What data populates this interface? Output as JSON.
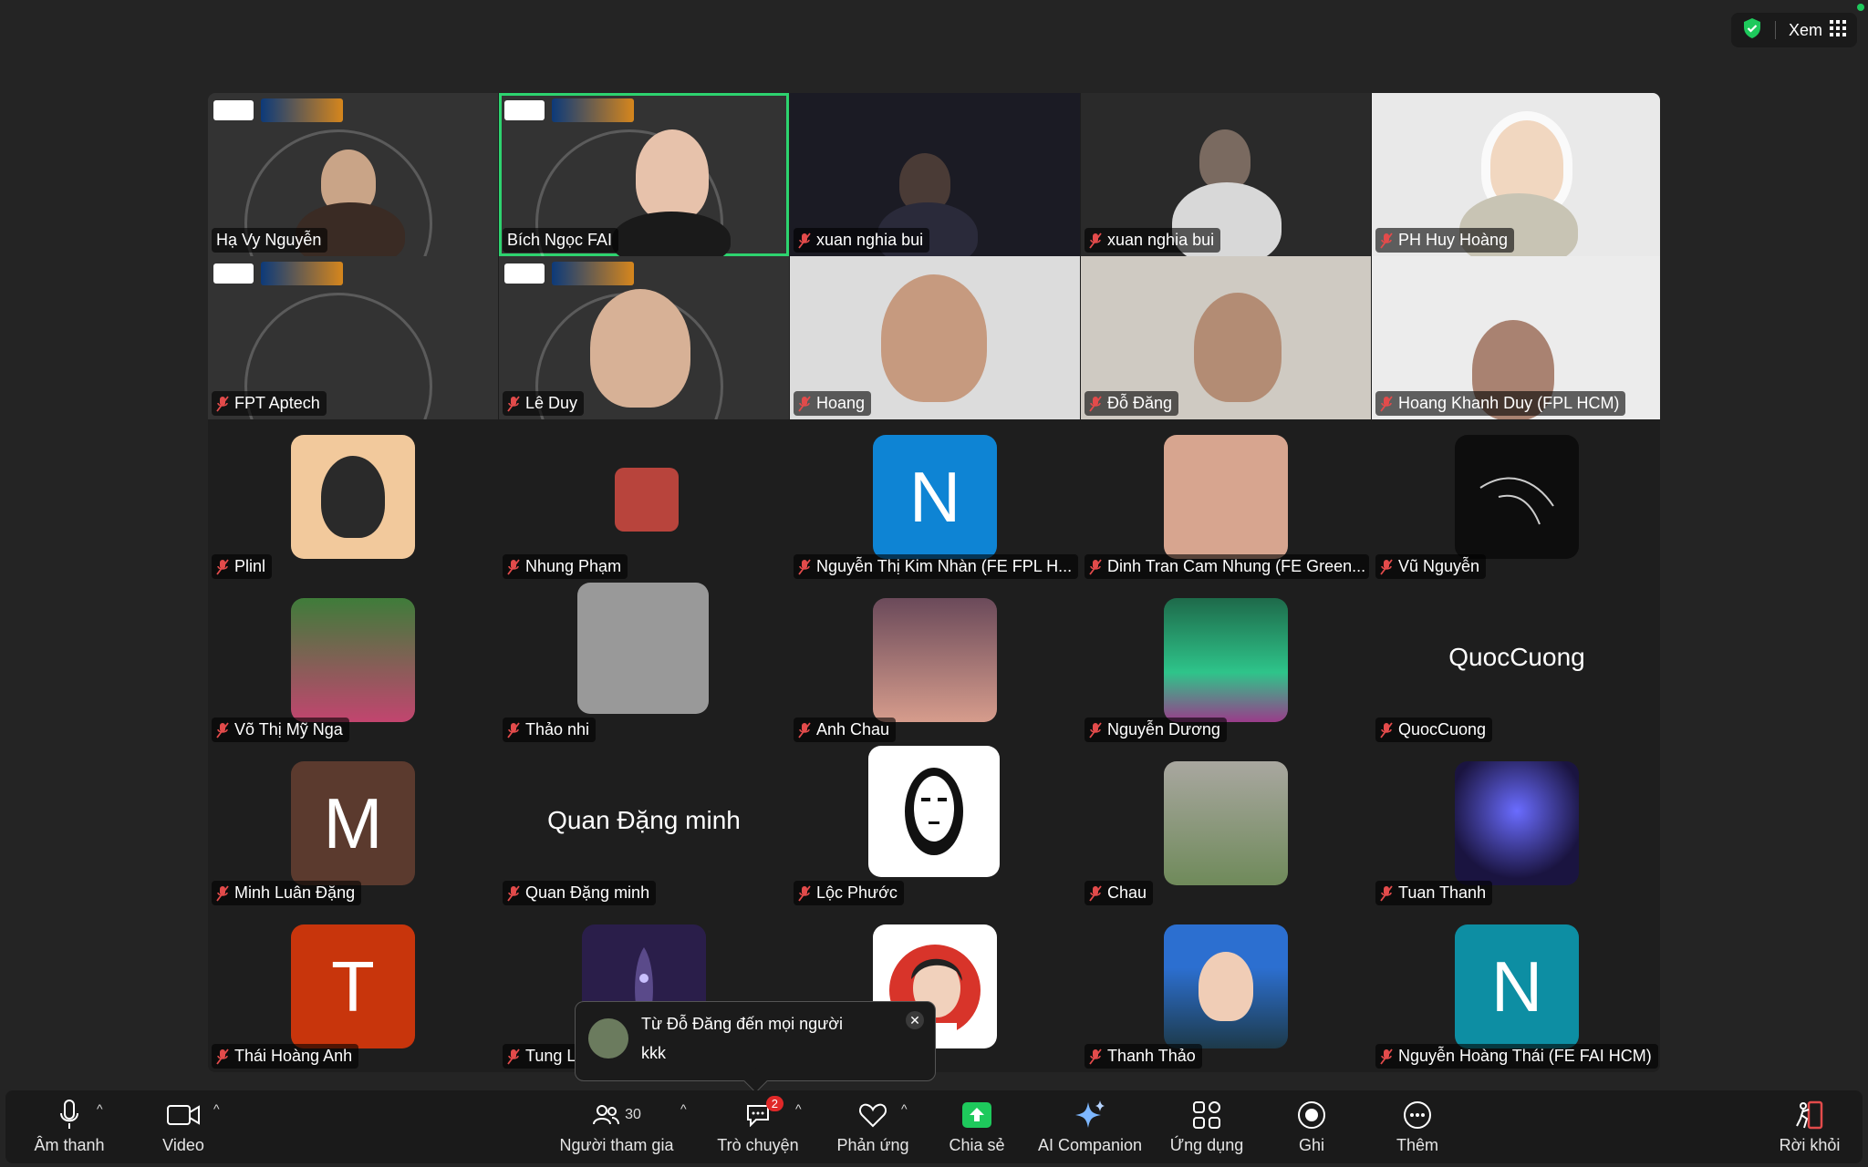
{
  "topbar": {
    "view_label": "Xem"
  },
  "tiles_video": [
    {
      "name": "Hạ Vy Nguyễn"
    },
    {
      "name": "Bích Ngọc FAI"
    },
    {
      "name": "xuan nghia bui"
    },
    {
      "name": "xuan nghia bui"
    },
    {
      "name": "PH Huy Hoàng"
    },
    {
      "name": "FPT Aptech"
    },
    {
      "name": "Lê Duy"
    },
    {
      "name": "Hoang"
    },
    {
      "name": "Đỗ Đăng"
    },
    {
      "name": "Hoang Khanh Duy (FPL HCM)"
    }
  ],
  "tiles_avatar": [
    {
      "name": "Plinl"
    },
    {
      "name": "Nhung Phạm"
    },
    {
      "name": "Nguyễn Thị Kim Nhàn (FE FPL H...",
      "letter": "N"
    },
    {
      "name": "Dinh Tran Cam Nhung (FE Green..."
    },
    {
      "name": "Vũ Nguyễn"
    },
    {
      "name": "Võ Thị Mỹ Nga"
    },
    {
      "name": "Thảo nhi"
    },
    {
      "name": "Anh Chau"
    },
    {
      "name": "Nguyễn Dương"
    },
    {
      "name": "QuocCuong",
      "display": "QuocCuong"
    },
    {
      "name": "Minh Luân Đặng",
      "letter": "M"
    },
    {
      "name": "Quan Đặng minh",
      "display": "Quan Đặng minh"
    },
    {
      "name": "Lộc Phước"
    },
    {
      "name": "Chau"
    },
    {
      "name": "Tuan Thanh"
    },
    {
      "name": "Thái Hoàng Anh",
      "letter": "T"
    },
    {
      "name": "Tung L"
    },
    {
      "name": ""
    },
    {
      "name": "Thanh Thảo"
    },
    {
      "name": "Nguyễn Hoàng Thái (FE FAI HCM)",
      "letter": "N"
    }
  ],
  "chat_popup": {
    "from": "Từ Đỗ Đăng đến mọi người",
    "message": "kkk"
  },
  "toolbar": {
    "audio": "Âm thanh",
    "video": "Video",
    "participants": "Người tham gia",
    "participants_count": "30",
    "chat": "Trò chuyện",
    "chat_badge": "2",
    "reactions": "Phản ứng",
    "share": "Chia sẻ",
    "ai": "AI Companion",
    "apps": "Ứng dụng",
    "record": "Ghi",
    "more": "Thêm",
    "leave": "Rời khỏi"
  },
  "colors": {
    "share_green": "#1ec95c",
    "active_border": "#2dd36f",
    "badge_red": "#e02828"
  }
}
